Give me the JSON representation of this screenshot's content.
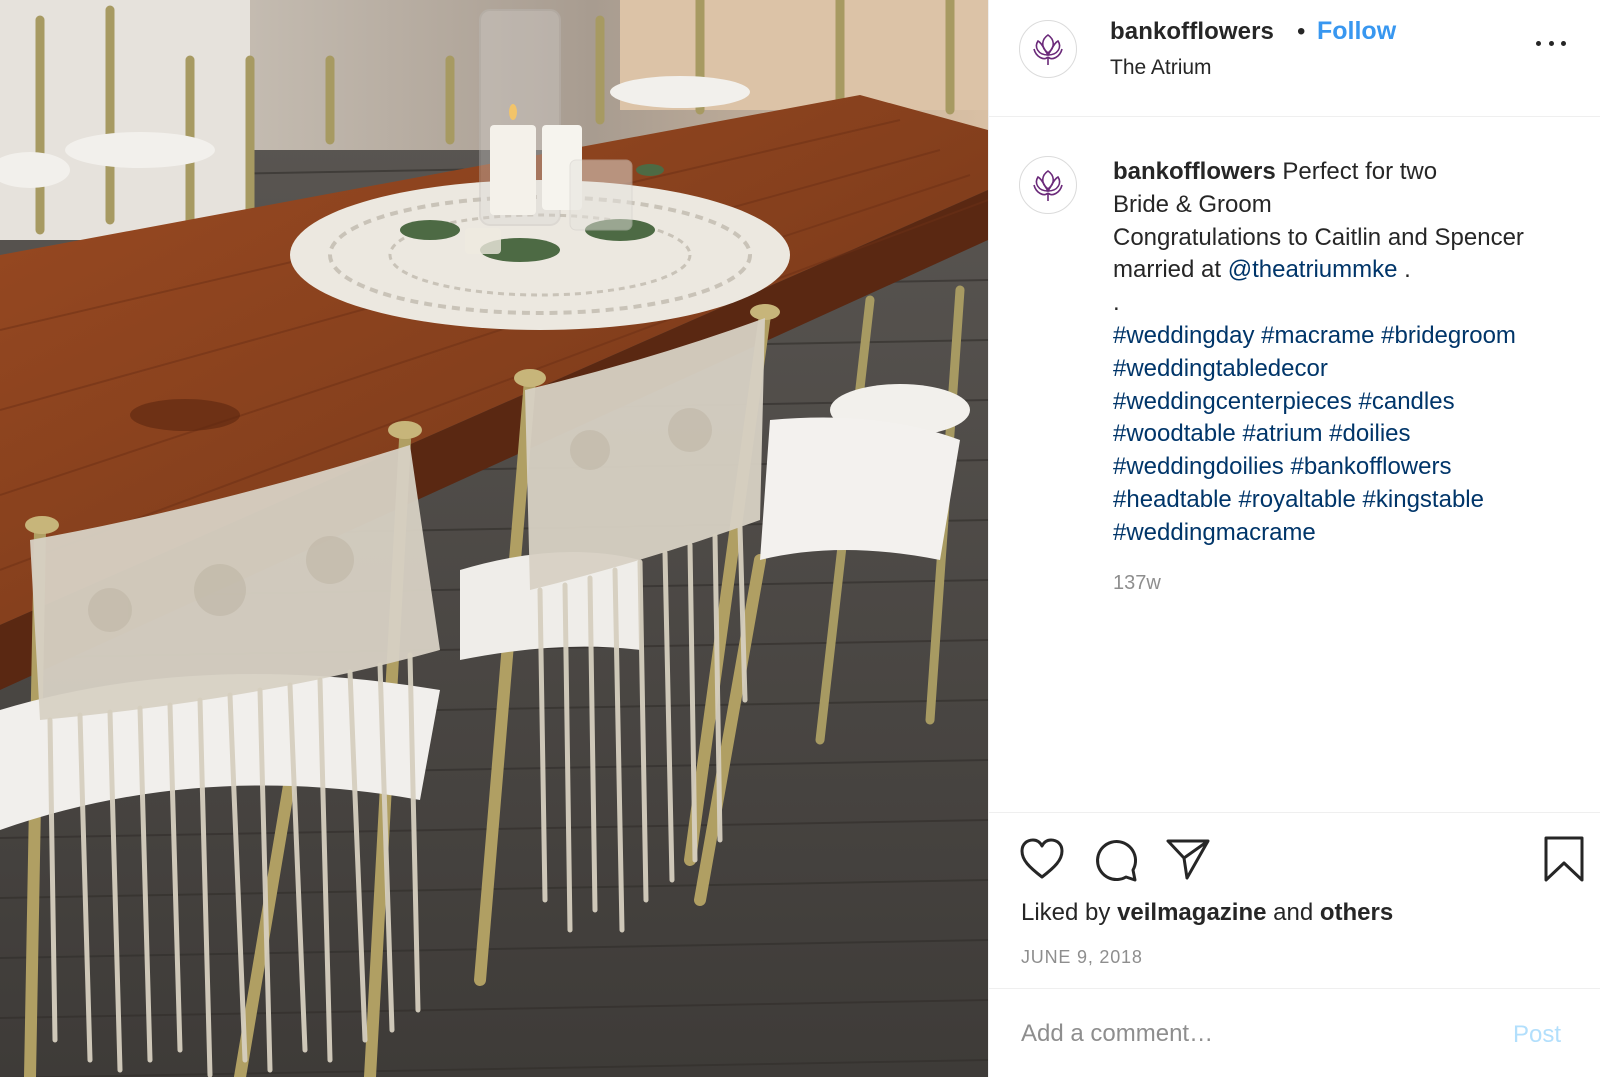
{
  "post": {
    "photo_alt": "",
    "username": "bankofflowers",
    "separator": "•",
    "follow_label": "Follow",
    "location": "The Atrium",
    "more_icon": "more-horizontal-icon"
  },
  "caption": {
    "username": "bankofflowers",
    "line1": "Perfect for two",
    "line2": "Bride & Groom",
    "line3": "Congratulations to Caitlin and Spencer",
    "line4_prefix": "married at",
    "mention": "@theatriummke",
    "line4_suffix": ".",
    "line5": ".",
    "hashtags": [
      [
        "#weddingday",
        "#macrame",
        "#bridegroom"
      ],
      [
        "#weddingtabledecor"
      ],
      [
        "#weddingcenterpieces",
        "#candles"
      ],
      [
        "#woodtable",
        "#atrium",
        "#doilies"
      ],
      [
        "#weddingdoilies",
        "#bankofflowers"
      ],
      [
        "#headtable",
        "#royaltable",
        "#kingstable"
      ],
      [
        "#weddingmacrame"
      ]
    ],
    "time_ago": "137w"
  },
  "actions": {
    "icons": [
      "heart-icon",
      "comment-icon",
      "share-icon",
      "bookmark-icon"
    ],
    "liked_prefix": "Liked by",
    "liked_user": "veilmagazine",
    "liked_and": "and",
    "liked_others": "others",
    "date": "JUNE 9, 2018"
  },
  "comment": {
    "placeholder": "Add a comment…",
    "post_label": "Post"
  },
  "colors": {
    "link": "#003569",
    "follow": "#3897f0",
    "post_disabled": "#b2dffc",
    "muted": "#8e8e8e",
    "brand_purple": "#6b2a7a"
  }
}
